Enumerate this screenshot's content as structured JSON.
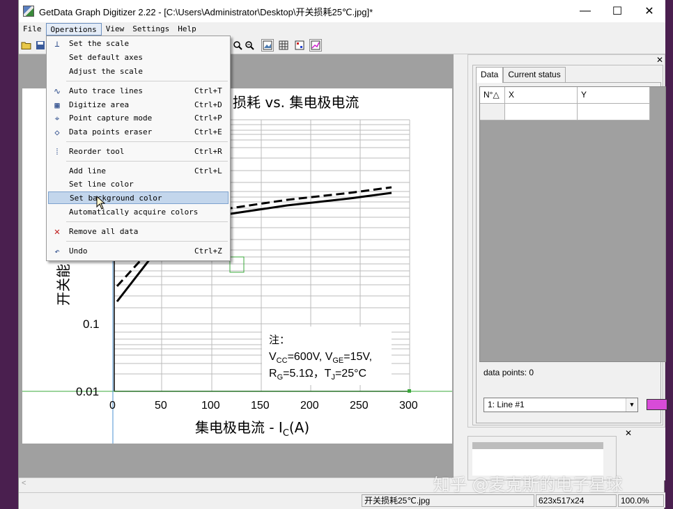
{
  "titlebar": {
    "title": "GetData Graph Digitizer 2.22 - [C:\\Users\\Administrator\\Desktop\\开关损耗25℃.jpg]*",
    "minimize": "—",
    "maximize": "☐",
    "close": "✕"
  },
  "menubar": {
    "items": [
      "File",
      "Operations",
      "View",
      "Settings",
      "Help"
    ]
  },
  "operations_menu": {
    "items": [
      {
        "label": "Set the scale",
        "shortcut": "",
        "icon": "axes-icon"
      },
      {
        "label": "Set default axes",
        "shortcut": "",
        "icon": ""
      },
      {
        "label": "Adjust the scale",
        "shortcut": "",
        "icon": ""
      },
      {
        "label": "Auto trace lines",
        "shortcut": "Ctrl+T",
        "icon": "trace-icon"
      },
      {
        "label": "Digitize area",
        "shortcut": "Ctrl+D",
        "icon": "area-icon"
      },
      {
        "label": "Point capture mode",
        "shortcut": "Ctrl+P",
        "icon": "crosshair-icon"
      },
      {
        "label": "Data points eraser",
        "shortcut": "Ctrl+E",
        "icon": "eraser-icon"
      },
      {
        "label": "Reorder tool",
        "shortcut": "Ctrl+R",
        "icon": "reorder-icon"
      },
      {
        "label": "Add line",
        "shortcut": "Ctrl+L",
        "icon": ""
      },
      {
        "label": "Set line color",
        "shortcut": "",
        "icon": ""
      },
      {
        "label": "Set background color",
        "shortcut": "",
        "icon": ""
      },
      {
        "label": "Automatically acquire colors",
        "shortcut": "",
        "icon": ""
      },
      {
        "label": "Remove all data",
        "shortcut": "",
        "icon": "remove-icon"
      },
      {
        "label": "Undo",
        "shortcut": "Ctrl+Z",
        "icon": "undo-icon"
      }
    ],
    "highlighted": "Set background color"
  },
  "graph": {
    "title": "损耗 vs. 集电极电流",
    "ylabel": "开关能",
    "xlabel_prefix": "集电极电流 - I",
    "xlabel_sub": "C",
    "xlabel_suffix": "(A)",
    "y_ticks": [
      "0.1",
      "0.01"
    ],
    "x_ticks": [
      "0",
      "50",
      "100",
      "150",
      "200",
      "250",
      "300"
    ],
    "note_title": "注：",
    "note_line1_a": "V",
    "note_line1_a_sub": "CC",
    "note_line1_b": "=600V, V",
    "note_line1_b_sub": "GE",
    "note_line1_c": "=15V,",
    "note_line2_a": "R",
    "note_line2_a_sub": "G",
    "note_line2_b": "=5.1Ω，T",
    "note_line2_b_sub": "J",
    "note_line2_c": "=25°C"
  },
  "data_panel": {
    "tabs": [
      "Data",
      "Current status"
    ],
    "columns": [
      "N°△",
      "X",
      "Y"
    ],
    "data_points_label": "data points: 0",
    "line_select": "1: Line #1",
    "line_color": "#d84bd8"
  },
  "statusbar": {
    "filename": "开关损耗25℃.jpg",
    "size": "623x517x24",
    "zoom": "100.0%"
  },
  "watermark": "知乎 @麦克斯的电子星球"
}
